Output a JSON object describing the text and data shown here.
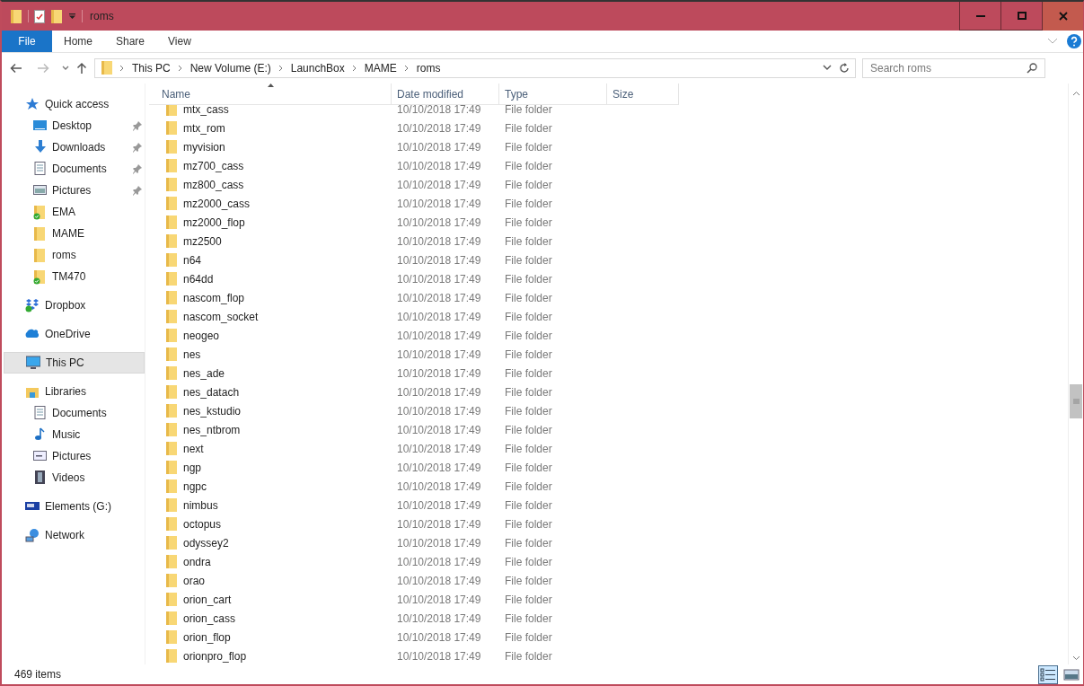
{
  "window": {
    "title": "roms"
  },
  "ribbon": {
    "tabs": [
      {
        "label": "File",
        "kind": "file",
        "selected": false
      },
      {
        "label": "Home",
        "kind": "tab",
        "selected": false
      },
      {
        "label": "Share",
        "kind": "tab",
        "selected": false
      },
      {
        "label": "View",
        "kind": "tab",
        "selected": false
      }
    ]
  },
  "address_bar": {
    "path": [
      "This PC",
      "New Volume (E:)",
      "LaunchBox",
      "MAME",
      "roms"
    ]
  },
  "search": {
    "placeholder": "Search roms"
  },
  "navigation_pane": {
    "items": [
      {
        "label": "Quick access",
        "selected": false,
        "children": [
          {
            "label": "Desktop",
            "pinned": true,
            "synced": false,
            "selected": false
          },
          {
            "label": "Downloads",
            "pinned": true,
            "synced": false,
            "selected": false
          },
          {
            "label": "Documents",
            "pinned": true,
            "synced": false,
            "selected": false
          },
          {
            "label": "Pictures",
            "pinned": true,
            "synced": false,
            "selected": false
          },
          {
            "label": "EMA",
            "pinned": false,
            "synced": true,
            "selected": false
          },
          {
            "label": "MAME",
            "pinned": false,
            "synced": false,
            "selected": false
          },
          {
            "label": "roms",
            "pinned": false,
            "synced": false,
            "selected": false
          },
          {
            "label": "TM470",
            "pinned": false,
            "synced": true,
            "selected": false
          }
        ]
      },
      {
        "label": "Dropbox",
        "selected": false
      },
      {
        "label": "OneDrive",
        "selected": false
      },
      {
        "label": "This PC",
        "selected": true
      },
      {
        "label": "Libraries",
        "selected": false,
        "children": [
          {
            "label": "Documents",
            "pinned": false,
            "synced": false,
            "selected": false
          },
          {
            "label": "Music",
            "pinned": false,
            "synced": false,
            "selected": false
          },
          {
            "label": "Pictures",
            "pinned": false,
            "synced": false,
            "selected": false
          },
          {
            "label": "Videos",
            "pinned": false,
            "synced": false,
            "selected": false
          }
        ]
      },
      {
        "label": "Elements (G:)",
        "selected": false
      },
      {
        "label": "Network",
        "selected": false
      }
    ]
  },
  "file_list": {
    "columns": [
      {
        "label": "Name",
        "sorted": true
      },
      {
        "label": "Date modified",
        "sorted": false
      },
      {
        "label": "Type",
        "sorted": false
      },
      {
        "label": "Size",
        "sorted": false
      }
    ],
    "rows": [
      {
        "name": "mtx_cass",
        "date_modified": "10/10/2018 17:49",
        "type": "File folder"
      },
      {
        "name": "mtx_rom",
        "date_modified": "10/10/2018 17:49",
        "type": "File folder"
      },
      {
        "name": "myvision",
        "date_modified": "10/10/2018 17:49",
        "type": "File folder"
      },
      {
        "name": "mz700_cass",
        "date_modified": "10/10/2018 17:49",
        "type": "File folder"
      },
      {
        "name": "mz800_cass",
        "date_modified": "10/10/2018 17:49",
        "type": "File folder"
      },
      {
        "name": "mz2000_cass",
        "date_modified": "10/10/2018 17:49",
        "type": "File folder"
      },
      {
        "name": "mz2000_flop",
        "date_modified": "10/10/2018 17:49",
        "type": "File folder"
      },
      {
        "name": "mz2500",
        "date_modified": "10/10/2018 17:49",
        "type": "File folder"
      },
      {
        "name": "n64",
        "date_modified": "10/10/2018 17:49",
        "type": "File folder"
      },
      {
        "name": "n64dd",
        "date_modified": "10/10/2018 17:49",
        "type": "File folder"
      },
      {
        "name": "nascom_flop",
        "date_modified": "10/10/2018 17:49",
        "type": "File folder"
      },
      {
        "name": "nascom_socket",
        "date_modified": "10/10/2018 17:49",
        "type": "File folder"
      },
      {
        "name": "neogeo",
        "date_modified": "10/10/2018 17:49",
        "type": "File folder"
      },
      {
        "name": "nes",
        "date_modified": "10/10/2018 17:49",
        "type": "File folder"
      },
      {
        "name": "nes_ade",
        "date_modified": "10/10/2018 17:49",
        "type": "File folder"
      },
      {
        "name": "nes_datach",
        "date_modified": "10/10/2018 17:49",
        "type": "File folder"
      },
      {
        "name": "nes_kstudio",
        "date_modified": "10/10/2018 17:49",
        "type": "File folder"
      },
      {
        "name": "nes_ntbrom",
        "date_modified": "10/10/2018 17:49",
        "type": "File folder"
      },
      {
        "name": "next",
        "date_modified": "10/10/2018 17:49",
        "type": "File folder"
      },
      {
        "name": "ngp",
        "date_modified": "10/10/2018 17:49",
        "type": "File folder"
      },
      {
        "name": "ngpc",
        "date_modified": "10/10/2018 17:49",
        "type": "File folder"
      },
      {
        "name": "nimbus",
        "date_modified": "10/10/2018 17:49",
        "type": "File folder"
      },
      {
        "name": "octopus",
        "date_modified": "10/10/2018 17:49",
        "type": "File folder"
      },
      {
        "name": "odyssey2",
        "date_modified": "10/10/2018 17:49",
        "type": "File folder"
      },
      {
        "name": "ondra",
        "date_modified": "10/10/2018 17:49",
        "type": "File folder"
      },
      {
        "name": "orao",
        "date_modified": "10/10/2018 17:49",
        "type": "File folder"
      },
      {
        "name": "orion_cart",
        "date_modified": "10/10/2018 17:49",
        "type": "File folder"
      },
      {
        "name": "orion_cass",
        "date_modified": "10/10/2018 17:49",
        "type": "File folder"
      },
      {
        "name": "orion_flop",
        "date_modified": "10/10/2018 17:49",
        "type": "File folder"
      },
      {
        "name": "orionpro_flop",
        "date_modified": "10/10/2018 17:49",
        "type": "File folder"
      }
    ]
  },
  "status_bar": {
    "item_count": "469 items",
    "views": [
      {
        "kind": "details",
        "selected": true
      },
      {
        "kind": "large-icons",
        "selected": false
      }
    ]
  }
}
